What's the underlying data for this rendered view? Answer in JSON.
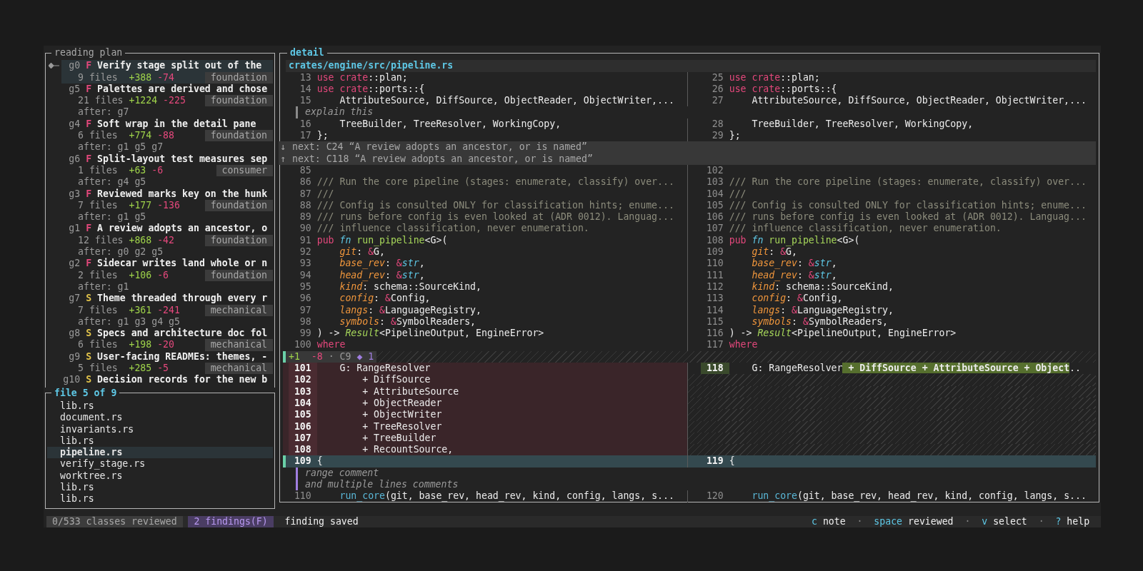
{
  "plan": {
    "title": "reading plan",
    "groups": [
      {
        "id": "g0",
        "tier": "F",
        "title": "Verify stage split out of the",
        "files": "9 files",
        "added": "+388",
        "removed": "-74",
        "tag": "foundation",
        "selected": true
      },
      {
        "id": "g5",
        "tier": "F",
        "title": "Palettes are derived and chose",
        "files": "21 files",
        "added": "+1224",
        "removed": "-225",
        "tag": "foundation",
        "after": "after: g7",
        "selected": false
      },
      {
        "id": "g4",
        "tier": "F",
        "title": "Soft wrap in the detail pane",
        "files": "6 files",
        "added": "+774",
        "removed": "-88",
        "tag": "foundation",
        "after": "after: g1 g5 g7",
        "selected": false
      },
      {
        "id": "g6",
        "tier": "F",
        "title": "Split-layout test measures sep",
        "files": "1 files",
        "added": "+63",
        "removed": "-6",
        "tag": "consumer",
        "after": "after: g4 g5",
        "selected": false
      },
      {
        "id": "g3",
        "tier": "F",
        "title": "Reviewed marks key on the hunk",
        "files": "7 files",
        "added": "+177",
        "removed": "-136",
        "tag": "foundation",
        "after": "after: g1 g5",
        "selected": false
      },
      {
        "id": "g1",
        "tier": "F",
        "title": "A review adopts an ancestor, o",
        "files": "12 files",
        "added": "+868",
        "removed": "-42",
        "tag": "foundation",
        "after": "after: g0 g2 g5",
        "selected": false
      },
      {
        "id": "g2",
        "tier": "F",
        "title": "Sidecar writes land whole or n",
        "files": "2 files",
        "added": "+106",
        "removed": "-6",
        "tag": "foundation",
        "after": "after: g1",
        "selected": false
      },
      {
        "id": "g7",
        "tier": "S",
        "title": "Theme threaded through every r",
        "files": "7 files",
        "added": "+361",
        "removed": "-241",
        "tag": "mechanical",
        "after": "after: g1 g3 g4 g5",
        "selected": false
      },
      {
        "id": "g8",
        "tier": "S",
        "title": "Specs and architecture doc fol",
        "files": "6 files",
        "added": "+198",
        "removed": "-20",
        "tag": "mechanical",
        "selected": false
      },
      {
        "id": "g9",
        "tier": "S",
        "title": "User-facing READMEs: themes, -",
        "files": "5 files",
        "added": "+285",
        "removed": "-5",
        "tag": "mechanical",
        "selected": false
      },
      {
        "id": "g10",
        "tier": "S",
        "title": "Decision records for the new b",
        "selected": false
      }
    ]
  },
  "files": {
    "title": "file 5 of 9",
    "items": [
      {
        "name": "lib.rs",
        "selected": false
      },
      {
        "name": "document.rs",
        "selected": false
      },
      {
        "name": "invariants.rs",
        "selected": false
      },
      {
        "name": "lib.rs",
        "selected": false
      },
      {
        "name": "pipeline.rs",
        "selected": true
      },
      {
        "name": "verify_stage.rs",
        "selected": false
      },
      {
        "name": "worktree.rs",
        "selected": false
      },
      {
        "name": "lib.rs",
        "selected": false
      },
      {
        "name": "lib.rs",
        "selected": false
      }
    ]
  },
  "detail": {
    "title": "detail",
    "path": "crates/engine/src/pipeline.rs",
    "rows": [
      {
        "kind": "code",
        "left": {
          "num": "13",
          "code": [
            {
              "kind": "kw",
              "text": "use crate"
            },
            {
              "kind": "p",
              "text": "::plan;"
            }
          ]
        },
        "right": {
          "num": "25",
          "code": [
            {
              "kind": "kw",
              "text": "use crate"
            },
            {
              "kind": "p",
              "text": "::plan;"
            }
          ]
        }
      },
      {
        "kind": "code",
        "left": {
          "num": "14",
          "code": [
            {
              "kind": "kw",
              "text": "use crate"
            },
            {
              "kind": "p",
              "text": "::ports::{"
            }
          ]
        },
        "right": {
          "num": "26",
          "code": [
            {
              "kind": "kw",
              "text": "use crate"
            },
            {
              "kind": "p",
              "text": "::ports::{"
            }
          ]
        }
      },
      {
        "kind": "code",
        "left": {
          "num": "15",
          "code": [
            {
              "kind": "p",
              "text": "    AttributeSource, DiffSource, ObjectReader, ObjectWriter,..."
            }
          ]
        },
        "right": {
          "num": "27",
          "code": [
            {
              "kind": "p",
              "text": "    AttributeSource, DiffSource, ObjectReader, ObjectWriter,..."
            }
          ]
        }
      },
      {
        "kind": "note",
        "range": false,
        "text": "explain this"
      },
      {
        "kind": "code",
        "left": {
          "num": "16",
          "code": [
            {
              "kind": "p",
              "text": "    TreeBuilder, TreeResolver, WorkingCopy,"
            }
          ]
        },
        "right": {
          "num": "28",
          "code": [
            {
              "kind": "p",
              "text": "    TreeBuilder, TreeResolver, WorkingCopy,"
            }
          ]
        }
      },
      {
        "kind": "code",
        "left": {
          "num": "17",
          "code": [
            {
              "kind": "p",
              "text": "};"
            }
          ]
        },
        "right": {
          "num": "29",
          "code": [
            {
              "kind": "p",
              "text": "};"
            }
          ]
        }
      },
      {
        "kind": "jump",
        "arrow": "↓",
        "text": "next: C24 “A review adopts an ancestor, or is named”"
      },
      {
        "kind": "jump",
        "arrow": "↑",
        "text": "next: C118 “A review adopts an ancestor, or is named”"
      },
      {
        "kind": "code",
        "left": {
          "num": "85"
        },
        "right": {
          "num": "102"
        }
      },
      {
        "kind": "code",
        "left": {
          "num": "86",
          "code": [
            {
              "kind": "cm",
              "text": "/// Run the core pipeline (stages: enumerate, classify) over..."
            }
          ]
        },
        "right": {
          "num": "103",
          "code": [
            {
              "kind": "cm",
              "text": "/// Run the core pipeline (stages: enumerate, classify) over..."
            }
          ]
        }
      },
      {
        "kind": "code",
        "left": {
          "num": "87",
          "code": [
            {
              "kind": "cm",
              "text": "///"
            }
          ]
        },
        "right": {
          "num": "104",
          "code": [
            {
              "kind": "cm",
              "text": "///"
            }
          ]
        }
      },
      {
        "kind": "code",
        "left": {
          "num": "88",
          "code": [
            {
              "kind": "cm",
              "text": "/// Config is consulted ONLY for classification hints; enume..."
            }
          ]
        },
        "right": {
          "num": "105",
          "code": [
            {
              "kind": "cm",
              "text": "/// Config is consulted ONLY for classification hints; enume..."
            }
          ]
        }
      },
      {
        "kind": "code",
        "left": {
          "num": "89",
          "code": [
            {
              "kind": "cm",
              "text": "/// runs before config is even looked at (ADR 0012). Languag..."
            }
          ]
        },
        "right": {
          "num": "106",
          "code": [
            {
              "kind": "cm",
              "text": "/// runs before config is even looked at (ADR 0012). Languag..."
            }
          ]
        }
      },
      {
        "kind": "code",
        "left": {
          "num": "90",
          "code": [
            {
              "kind": "cm",
              "text": "/// influence classification, never enumeration."
            }
          ]
        },
        "right": {
          "num": "107",
          "code": [
            {
              "kind": "cm",
              "text": "/// influence classification, never enumeration."
            }
          ]
        }
      },
      {
        "kind": "code",
        "left": {
          "num": "91",
          "code": [
            {
              "kind": "kw",
              "text": "pub "
            },
            {
              "kind": "ty",
              "text": "fn"
            },
            {
              "kind": "fn",
              "text": " run_pipeline"
            },
            {
              "kind": "p",
              "text": "<G>("
            }
          ]
        },
        "right": {
          "num": "108",
          "code": [
            {
              "kind": "kw",
              "text": "pub "
            },
            {
              "kind": "ty",
              "text": "fn"
            },
            {
              "kind": "fn",
              "text": " run_pipeline"
            },
            {
              "kind": "p",
              "text": "<G>("
            }
          ]
        }
      },
      {
        "kind": "code",
        "left": {
          "num": "92",
          "code": [
            {
              "kind": "pa",
              "text": "    git"
            },
            {
              "kind": "p",
              "text": ": "
            },
            {
              "kind": "kw",
              "text": "&"
            },
            {
              "kind": "p",
              "text": "G,"
            }
          ]
        },
        "right": {
          "num": "109",
          "code": [
            {
              "kind": "pa",
              "text": "    git"
            },
            {
              "kind": "p",
              "text": ": "
            },
            {
              "kind": "kw",
              "text": "&"
            },
            {
              "kind": "p",
              "text": "G,"
            }
          ]
        }
      },
      {
        "kind": "code",
        "left": {
          "num": "93",
          "code": [
            {
              "kind": "pa",
              "text": "    base_rev"
            },
            {
              "kind": "p",
              "text": ": "
            },
            {
              "kind": "kw",
              "text": "&"
            },
            {
              "kind": "ty",
              "text": "str"
            },
            {
              "kind": "p",
              "text": ","
            }
          ]
        },
        "right": {
          "num": "110",
          "code": [
            {
              "kind": "pa",
              "text": "    base_rev"
            },
            {
              "kind": "p",
              "text": ": "
            },
            {
              "kind": "kw",
              "text": "&"
            },
            {
              "kind": "ty",
              "text": "str"
            },
            {
              "kind": "p",
              "text": ","
            }
          ]
        }
      },
      {
        "kind": "code",
        "left": {
          "num": "94",
          "code": [
            {
              "kind": "pa",
              "text": "    head_rev"
            },
            {
              "kind": "p",
              "text": ": "
            },
            {
              "kind": "kw",
              "text": "&"
            },
            {
              "kind": "ty",
              "text": "str"
            },
            {
              "kind": "p",
              "text": ","
            }
          ]
        },
        "right": {
          "num": "111",
          "code": [
            {
              "kind": "pa",
              "text": "    head_rev"
            },
            {
              "kind": "p",
              "text": ": "
            },
            {
              "kind": "kw",
              "text": "&"
            },
            {
              "kind": "ty",
              "text": "str"
            },
            {
              "kind": "p",
              "text": ","
            }
          ]
        }
      },
      {
        "kind": "code",
        "left": {
          "num": "95",
          "code": [
            {
              "kind": "pa",
              "text": "    kind"
            },
            {
              "kind": "p",
              "text": ": schema::SourceKind,"
            }
          ]
        },
        "right": {
          "num": "112",
          "code": [
            {
              "kind": "pa",
              "text": "    kind"
            },
            {
              "kind": "p",
              "text": ": schema::SourceKind,"
            }
          ]
        }
      },
      {
        "kind": "code",
        "left": {
          "num": "96",
          "code": [
            {
              "kind": "pa",
              "text": "    config"
            },
            {
              "kind": "p",
              "text": ": "
            },
            {
              "kind": "kw",
              "text": "&"
            },
            {
              "kind": "p",
              "text": "Config,"
            }
          ]
        },
        "right": {
          "num": "113",
          "code": [
            {
              "kind": "pa",
              "text": "    config"
            },
            {
              "kind": "p",
              "text": ": "
            },
            {
              "kind": "kw",
              "text": "&"
            },
            {
              "kind": "p",
              "text": "Config,"
            }
          ]
        }
      },
      {
        "kind": "code",
        "left": {
          "num": "97",
          "code": [
            {
              "kind": "pa",
              "text": "    langs"
            },
            {
              "kind": "p",
              "text": ": "
            },
            {
              "kind": "kw",
              "text": "&"
            },
            {
              "kind": "p",
              "text": "LanguageRegistry,"
            }
          ]
        },
        "right": {
          "num": "114",
          "code": [
            {
              "kind": "pa",
              "text": "    langs"
            },
            {
              "kind": "p",
              "text": ": "
            },
            {
              "kind": "kw",
              "text": "&"
            },
            {
              "kind": "p",
              "text": "LanguageRegistry,"
            }
          ]
        }
      },
      {
        "kind": "code",
        "left": {
          "num": "98",
          "code": [
            {
              "kind": "pa",
              "text": "    symbols"
            },
            {
              "kind": "p",
              "text": ": "
            },
            {
              "kind": "kw",
              "text": "&"
            },
            {
              "kind": "p",
              "text": "SymbolReaders,"
            }
          ]
        },
        "right": {
          "num": "115",
          "code": [
            {
              "kind": "pa",
              "text": "    symbols"
            },
            {
              "kind": "p",
              "text": ": "
            },
            {
              "kind": "kw",
              "text": "&"
            },
            {
              "kind": "p",
              "text": "SymbolReaders,"
            }
          ]
        }
      },
      {
        "kind": "code",
        "left": {
          "num": "99",
          "code": [
            {
              "kind": "p",
              "text": ") -> "
            },
            {
              "kind": "rt",
              "text": "Result"
            },
            {
              "kind": "p",
              "text": "<PipelineOutput, EngineError>"
            }
          ]
        },
        "right": {
          "num": "116",
          "code": [
            {
              "kind": "p",
              "text": ") -> "
            },
            {
              "kind": "rt",
              "text": "Result"
            },
            {
              "kind": "p",
              "text": "<PipelineOutput, EngineError>"
            }
          ]
        }
      },
      {
        "kind": "code",
        "left": {
          "num": "100",
          "code": [
            {
              "kind": "kw",
              "text": "where"
            }
          ]
        },
        "right": {
          "num": "117",
          "code": [
            {
              "kind": "kw",
              "text": "where"
            }
          ]
        }
      },
      {
        "kind": "hunk",
        "added": "+1",
        "removed": "-8",
        "sep": "·",
        "comment": "C9",
        "notes": "◆ 1"
      },
      {
        "kind": "code",
        "left": {
          "num": "101",
          "removed": true,
          "code": [
            {
              "kind": "p",
              "text": "    G: RangeResolver"
            }
          ]
        },
        "right": {
          "num": "118",
          "added": true,
          "code": [
            {
              "kind": "p",
              "text": "    G: RangeResolver"
            },
            {
              "kind": "ins",
              "text": " + DiffSource + AttributeSource + Object"
            },
            {
              "kind": "p",
              "text": ".."
            }
          ]
        }
      },
      {
        "kind": "code",
        "left": {
          "num": "102",
          "removed": true,
          "code": [
            {
              "kind": "p",
              "text": "        + DiffSource"
            }
          ]
        },
        "right": null
      },
      {
        "kind": "code",
        "left": {
          "num": "103",
          "removed": true,
          "code": [
            {
              "kind": "p",
              "text": "        + AttributeSource"
            }
          ]
        },
        "right": null
      },
      {
        "kind": "code",
        "left": {
          "num": "104",
          "removed": true,
          "code": [
            {
              "kind": "p",
              "text": "        + ObjectReader"
            }
          ]
        },
        "right": null
      },
      {
        "kind": "code",
        "left": {
          "num": "105",
          "removed": true,
          "code": [
            {
              "kind": "p",
              "text": "        + ObjectWriter"
            }
          ]
        },
        "right": null
      },
      {
        "kind": "code",
        "left": {
          "num": "106",
          "removed": true,
          "code": [
            {
              "kind": "p",
              "text": "        + TreeResolver"
            }
          ]
        },
        "right": null
      },
      {
        "kind": "code",
        "left": {
          "num": "107",
          "removed": true,
          "code": [
            {
              "kind": "p",
              "text": "        + TreeBuilder"
            }
          ]
        },
        "right": null
      },
      {
        "kind": "code",
        "left": {
          "num": "108",
          "removed": true,
          "code": [
            {
              "kind": "p",
              "text": "        + RecountSource,"
            }
          ]
        },
        "right": null
      },
      {
        "kind": "code",
        "current": true,
        "left": {
          "num": "109",
          "code": [
            {
              "kind": "p",
              "text": "{"
            }
          ]
        },
        "right": {
          "num": "119",
          "code": [
            {
              "kind": "p",
              "text": "{"
            }
          ]
        }
      },
      {
        "kind": "note",
        "range": true,
        "text": "range comment"
      },
      {
        "kind": "note",
        "range": true,
        "text": "and multiple lines comments"
      },
      {
        "kind": "code",
        "left": {
          "num": "110",
          "code": [
            {
              "kind": "call",
              "text": "    run_core"
            },
            {
              "kind": "p",
              "text": "(git, base_rev, head_rev, kind, config, langs, s..."
            }
          ]
        },
        "right": {
          "num": "120",
          "code": [
            {
              "kind": "call",
              "text": "    run_core"
            },
            {
              "kind": "p",
              "text": "(git, base_rev, head_rev, kind, config, langs, s..."
            }
          ]
        }
      }
    ]
  },
  "status_bar": {
    "progress": "0/533 classes reviewed",
    "findings": "2 findings(F)",
    "message": "finding saved",
    "hints": [
      {
        "kind": "hint",
        "key": "c",
        "label": "note"
      },
      {
        "kind": "sep",
        "text": "·"
      },
      {
        "kind": "hint",
        "key": "space",
        "label": "reviewed"
      },
      {
        "kind": "sep",
        "text": "·"
      },
      {
        "kind": "hint",
        "key": "v",
        "label": "select"
      },
      {
        "kind": "sep",
        "text": "·"
      },
      {
        "kind": "hint",
        "key": "?",
        "label": "help"
      }
    ]
  }
}
